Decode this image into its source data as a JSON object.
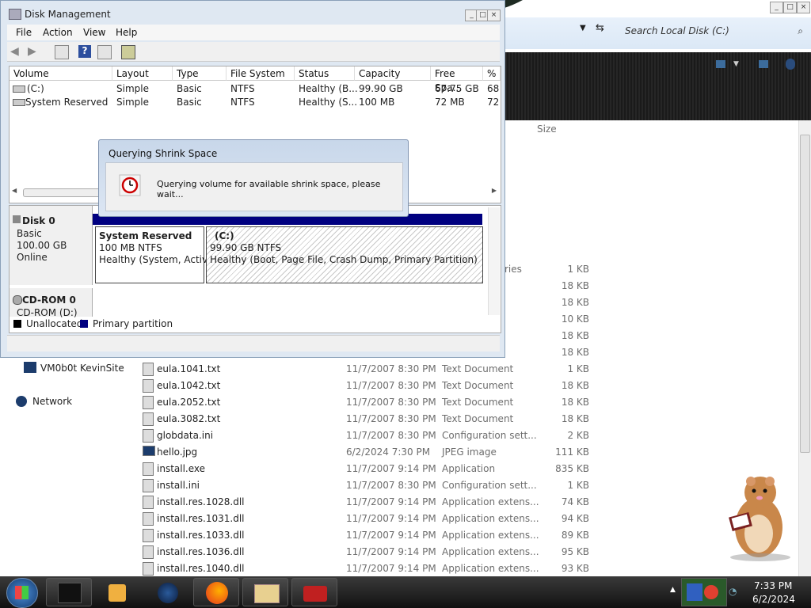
{
  "explorer": {
    "search_placeholder": "Search Local Disk (C:)",
    "col_size": "Size",
    "partial_type_top": "ries",
    "nav_items": [
      {
        "label": "VM0b0t KevinSite",
        "icon": "computer-icon"
      },
      {
        "label": "Network",
        "icon": "network-icon"
      }
    ],
    "upper_sizes": [
      "1 KB",
      "18 KB",
      "18 KB",
      "10 KB",
      "18 KB",
      "18 KB"
    ],
    "files": [
      {
        "name": "eula.1041.txt",
        "date": "11/7/2007 8:30 PM",
        "type": "Text Document",
        "size": "1 KB"
      },
      {
        "name": "eula.1042.txt",
        "date": "11/7/2007 8:30 PM",
        "type": "Text Document",
        "size": "18 KB"
      },
      {
        "name": "eula.2052.txt",
        "date": "11/7/2007 8:30 PM",
        "type": "Text Document",
        "size": "18 KB"
      },
      {
        "name": "eula.3082.txt",
        "date": "11/7/2007 8:30 PM",
        "type": "Text Document",
        "size": "18 KB"
      },
      {
        "name": "globdata.ini",
        "date": "11/7/2007 8:30 PM",
        "type": "Configuration sett...",
        "size": "2 KB"
      },
      {
        "name": "hello.jpg",
        "date": "6/2/2024 7:30 PM",
        "type": "JPEG image",
        "size": "111 KB"
      },
      {
        "name": "install.exe",
        "date": "11/7/2007 9:14 PM",
        "type": "Application",
        "size": "835 KB"
      },
      {
        "name": "install.ini",
        "date": "11/7/2007 8:30 PM",
        "type": "Configuration sett...",
        "size": "1 KB"
      },
      {
        "name": "install.res.1028.dll",
        "date": "11/7/2007 9:14 PM",
        "type": "Application extens...",
        "size": "74 KB"
      },
      {
        "name": "install.res.1031.dll",
        "date": "11/7/2007 9:14 PM",
        "type": "Application extens...",
        "size": "94 KB"
      },
      {
        "name": "install.res.1033.dll",
        "date": "11/7/2007 9:14 PM",
        "type": "Application extens...",
        "size": "89 KB"
      },
      {
        "name": "install.res.1036.dll",
        "date": "11/7/2007 9:14 PM",
        "type": "Application extens...",
        "size": "95 KB"
      },
      {
        "name": "install.res.1040.dll",
        "date": "11/7/2007 9:14 PM",
        "type": "Application extens...",
        "size": "93 KB"
      }
    ]
  },
  "disk_mgmt": {
    "title": "Disk Management",
    "menu": [
      "File",
      "Action",
      "View",
      "Help"
    ],
    "columns": [
      "Volume",
      "Layout",
      "Type",
      "File System",
      "Status",
      "Capacity",
      "Free Spa...",
      "%"
    ],
    "volumes": [
      {
        "volume": "(C:)",
        "layout": "Simple",
        "type": "Basic",
        "fs": "NTFS",
        "status": "Healthy (B...",
        "capacity": "99.90 GB",
        "free": "67.75 GB",
        "pct": "68"
      },
      {
        "volume": "System Reserved",
        "layout": "Simple",
        "type": "Basic",
        "fs": "NTFS",
        "status": "Healthy (S...",
        "capacity": "100 MB",
        "free": "72 MB",
        "pct": "72"
      }
    ],
    "disk0": {
      "name": "Disk 0",
      "kind": "Basic",
      "size": "100.00 GB",
      "state": "Online"
    },
    "cdrom0": {
      "name": "CD-ROM 0",
      "drive": "CD-ROM (D:)"
    },
    "part_sr": {
      "name": "System Reserved",
      "size": "100 MB NTFS",
      "status": "Healthy (System, Active"
    },
    "part_c": {
      "name": "(C:)",
      "size": "99.90 GB NTFS",
      "status": "Healthy (Boot, Page File, Crash Dump, Primary Partition)"
    },
    "legend": [
      {
        "label": "Unallocated",
        "color": "#000000"
      },
      {
        "label": "Primary partition",
        "color": "#000080"
      }
    ]
  },
  "dialog": {
    "title": "Querying Shrink Space",
    "message": "Querying volume for available shrink space, please wait..."
  },
  "taskbar": {
    "time": "7:33 PM",
    "date": "6/2/2024"
  }
}
